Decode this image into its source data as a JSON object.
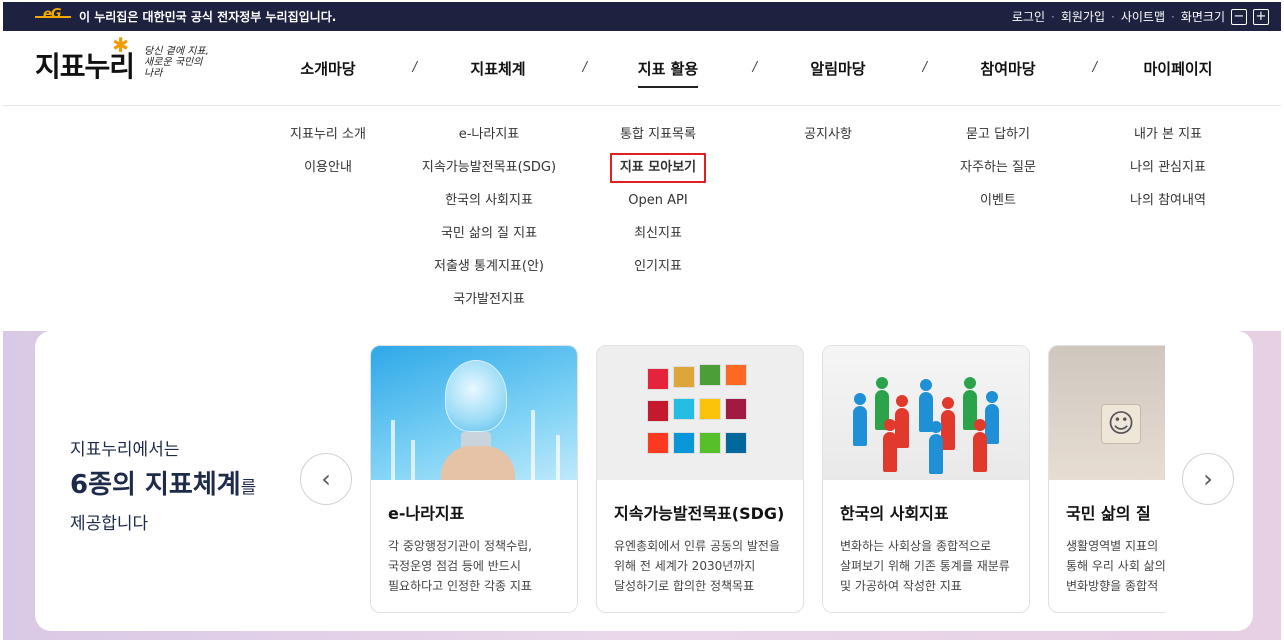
{
  "govbar": {
    "logo_text": "eG",
    "notice": "이 누리집은 대한민국 공식 전자정부 누리집입니다.",
    "links": [
      "로그인",
      "회원가입",
      "사이트맵"
    ],
    "zoom_label": "화면크기",
    "zoom_out": "−",
    "zoom_in": "+"
  },
  "header": {
    "logo": "지표누리",
    "slogan": "당신 곁에 지표, 새로운 국민의 나라",
    "nav": [
      "소개마당",
      "지표체계",
      "지표 활용",
      "알림마당",
      "참여마당",
      "마이페이지"
    ],
    "active_nav": "지표 활용"
  },
  "mega_menu": {
    "col1": [
      "지표누리 소개",
      "이용안내"
    ],
    "col2": [
      "e-나라지표",
      "지속가능발전목표(SDG)",
      "한국의 사회지표",
      "국민 삶의 질 지표",
      "저출생 통계지표(안)",
      "국가발전지표"
    ],
    "col3": [
      "통합 지표목록",
      "지표 모아보기",
      "Open API",
      "최신지표",
      "인기지표"
    ],
    "col4": [
      "공지사항"
    ],
    "col5": [
      "묻고 답하기",
      "자주하는 질문",
      "이벤트"
    ],
    "col6": [
      "내가 본 지표",
      "나의 관심지표",
      "나의 참여내역"
    ],
    "highlighted": "지표 모아보기"
  },
  "intro": {
    "line1": "지표누리에서는",
    "line2_bold": "6종의 지표체계",
    "line2_suffix": "를",
    "line3": "제공합니다"
  },
  "cards": [
    {
      "title": "e-나라지표",
      "desc": "각 중앙행정기관이 정책수립,\n국정운영 점검 등에 반드시\n필요하다고 인정한 각종 지표"
    },
    {
      "title": "지속가능발전목표(SDG)",
      "desc": "유엔총회에서 인류 공동의 발전을\n위해 전 세계가 2030년까지\n달성하기로 합의한 정책목표"
    },
    {
      "title": "한국의 사회지표",
      "desc": "변화하는 사회상을 종합적으로\n살펴보기 위해 기존 통계를 재분류\n및 가공하여 작성한 지표"
    },
    {
      "title": "국민 삶의 질",
      "desc": "생활영역별 지표의\n통해 우리 사회 삶의\n변화방향을 종합적"
    }
  ],
  "arrows": {
    "prev": "‹",
    "next": "›"
  },
  "colors": {
    "govbar": "#1d2240",
    "accent": "#f29b00",
    "highlight_border": "#e0201f"
  }
}
